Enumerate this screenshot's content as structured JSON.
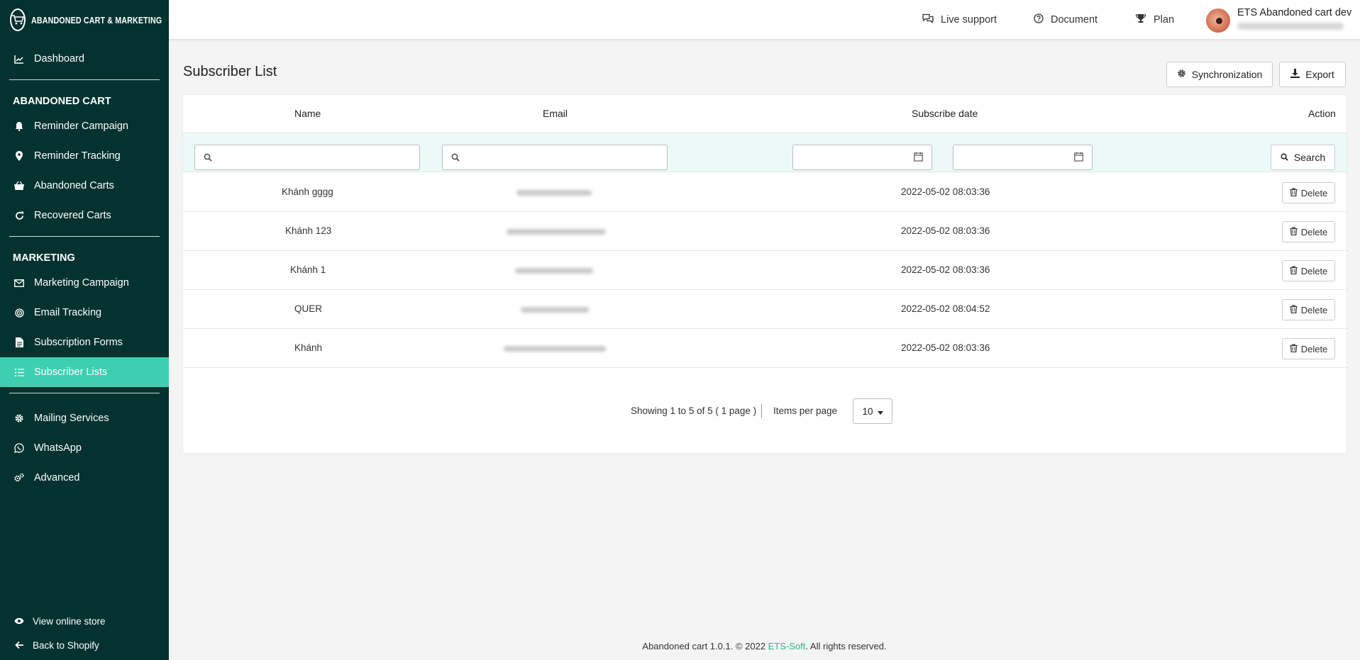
{
  "app": {
    "logo_text": "Abandoned Cart & Marketing"
  },
  "sidebar": {
    "dashboard": "Dashboard",
    "section_abandoned": "ABANDONED CART",
    "abandoned_items": [
      "Reminder Campaign",
      "Reminder Tracking",
      "Abandoned Carts",
      "Recovered Carts"
    ],
    "section_marketing": "MARKETING",
    "marketing_items": [
      "Marketing Campaign",
      "Email Tracking",
      "Subscription Forms",
      "Subscriber Lists"
    ],
    "other_items": [
      "Mailing Services",
      "WhatsApp",
      "Advanced"
    ],
    "view_store": "View online store",
    "back_shopify": "Back to Shopify"
  },
  "topbar": {
    "live_support": "Live support",
    "document": "Document",
    "plan": "Plan",
    "user_name": "ETS Abandoned cart dev"
  },
  "page": {
    "title": "Subscriber List",
    "sync_label": "Synchronization",
    "export_label": "Export"
  },
  "table": {
    "headers": {
      "name": "Name",
      "email": "Email",
      "date": "Subscribe date",
      "action": "Action"
    },
    "search_label": "Search",
    "delete_label": "Delete",
    "rows": [
      {
        "name": "Khánh gggg",
        "date": "2022-05-02 08:03:36"
      },
      {
        "name": "Khánh 123",
        "date": "2022-05-02 08:03:36"
      },
      {
        "name": "Khánh 1",
        "date": "2022-05-02 08:03:36"
      },
      {
        "name": "QUER",
        "date": "2022-05-02 08:04:52"
      },
      {
        "name": "Khánh",
        "date": "2022-05-02 08:03:36"
      }
    ]
  },
  "pagination": {
    "showing": "Showing 1 to 5 of 5 ( 1 page )",
    "items_per_page_label": "Items per page",
    "items_per_page": "10"
  },
  "footer": {
    "prefix": "Abandoned cart 1.0.1. © 2022 ",
    "brand": "ETS-Soft",
    "suffix": ". All rights reserved."
  },
  "colors": {
    "sidebar_bg": "#04322f",
    "accent": "#3ecfb0",
    "filter_bg": "#ebfaf6",
    "brand_link": "#2bb58f"
  }
}
